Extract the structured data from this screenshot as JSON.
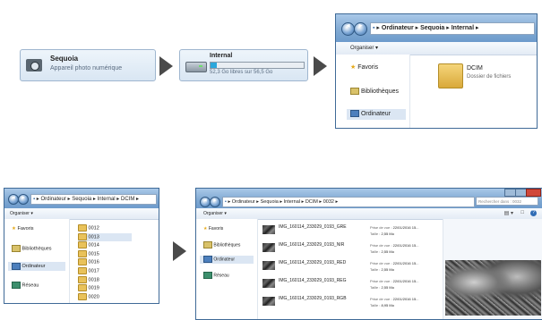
{
  "step1": {
    "name": "Sequoia",
    "subtitle": "Appareil photo numérique",
    "icon": "camera-icon"
  },
  "step2": {
    "name": "Internal",
    "free": "52,3 Go libres sur 56,5 Go",
    "used_fraction": 0.07,
    "icon": "drive-icon"
  },
  "win1": {
    "breadcrumb": [
      "Ordinateur",
      "Sequoia",
      "Internal"
    ],
    "organise": "Organiser",
    "nav": [
      "Favoris",
      "Bibliothèques",
      "Ordinateur"
    ],
    "folder": {
      "name": "DCIM",
      "type": "Dossier de fichiers"
    }
  },
  "win2": {
    "breadcrumb": [
      "Ordinateur",
      "Sequoia",
      "Internal",
      "DCIM"
    ],
    "organise": "Organiser",
    "nav": [
      "Favoris",
      "Bibliothèques",
      "Ordinateur",
      "Réseau"
    ],
    "folders": [
      "0012",
      "0013",
      "0014",
      "0015",
      "0016",
      "0017",
      "0018",
      "0019",
      "0020"
    ],
    "selected_folder": "0013"
  },
  "win3": {
    "breadcrumb": [
      "Ordinateur",
      "Sequoia",
      "Internal",
      "DCIM",
      "0032"
    ],
    "search_placeholder": "Rechercher dans : 0032",
    "organise": "Organiser",
    "nav": [
      "Favoris",
      "Bibliothèques",
      "Ordinateur",
      "Réseau"
    ],
    "files": [
      {
        "name": "IMG_160114_233029_0193_GRE",
        "date_label": "Prise de vue :",
        "date": "22/01/2016 15...",
        "size_label": "Taille :",
        "size": "2,55 Mo"
      },
      {
        "name": "IMG_160114_233029_0193_NIR",
        "date_label": "Prise de vue :",
        "date": "22/01/2016 15...",
        "size_label": "Taille :",
        "size": "2,55 Mo"
      },
      {
        "name": "IMG_160114_233029_0193_RED",
        "date_label": "Prise de vue :",
        "date": "22/01/2016 15...",
        "size_label": "Taille :",
        "size": "2,55 Mo"
      },
      {
        "name": "IMG_160114_233029_0193_REG",
        "date_label": "Prise de vue :",
        "date": "22/01/2016 15...",
        "size_label": "Taille :",
        "size": "2,55 Mo"
      },
      {
        "name": "IMG_160114_233029_0193_RGB",
        "date_label": "Prise de vue :",
        "date": "22/01/2016 15...",
        "size_label": "Taille :",
        "size": "8,95 Mo"
      }
    ]
  },
  "colors": {
    "accent": "#3f6a97",
    "arrow": "#4a4a4a",
    "folder": "#e9c25a"
  }
}
